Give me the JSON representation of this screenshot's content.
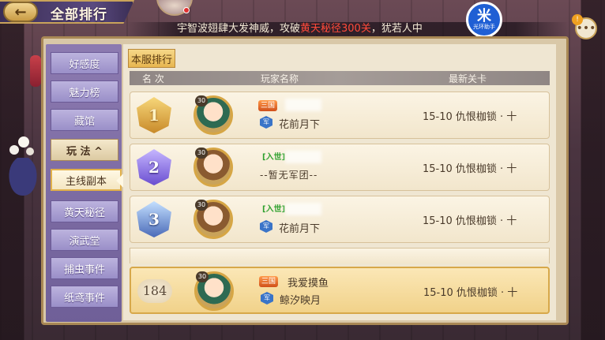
{
  "topbar": {
    "back_symbol": "←",
    "title": "全部排行",
    "marquee_prefix": "宇智波翅肆大发神威，攻破",
    "marquee_highlight": "黄天秘径300关",
    "marquee_suffix": "，犹若人中",
    "brand_big": "米",
    "brand_small": "光环助手",
    "chat_icon": "•••",
    "chat_badge": "!"
  },
  "sidebar": {
    "items": [
      {
        "label": "好感度"
      },
      {
        "label": "魅力榜"
      },
      {
        "label": "藏馆"
      },
      {
        "label": "玩 法 ^"
      },
      {
        "label": "主线副本"
      },
      {
        "label": "黄天秘径"
      },
      {
        "label": "演武堂"
      },
      {
        "label": "捕虫事件"
      },
      {
        "label": "纸鸢事件"
      }
    ],
    "active_index": 4,
    "group_index": 3
  },
  "main": {
    "tab_label": "本服排行",
    "headers": {
      "rank": "名 次",
      "player": "玩家名称",
      "stage": "最新关卡"
    },
    "rows": [
      {
        "rank": "1",
        "level": "30",
        "tag": "三国",
        "name": "",
        "guild_icon": "军",
        "guild": "花前月下",
        "stage": "15-10 仇恨枷锁 · 十"
      },
      {
        "rank": "2",
        "level": "30",
        "tag": "[入世]",
        "name": "",
        "guild_icon": "",
        "guild": "--暂无军团--",
        "stage": "15-10 仇恨枷锁 · 十"
      },
      {
        "rank": "3",
        "level": "30",
        "tag": "[入世]",
        "name": "",
        "guild_icon": "军",
        "guild": "花前月下",
        "stage": "15-10 仇恨枷锁 · 十"
      }
    ],
    "self_row": {
      "rank": "184",
      "level": "30",
      "tag": "三国",
      "name": "我爱摸鱼",
      "guild_icon": "军",
      "guild": "鲸汐映月",
      "stage": "15-10 仇恨枷锁 · 十"
    }
  },
  "colors": {
    "accent_gold": "#e1b04a",
    "sidebar_purple": "#8c7ab0",
    "highlight_red": "#ff4a3a"
  }
}
